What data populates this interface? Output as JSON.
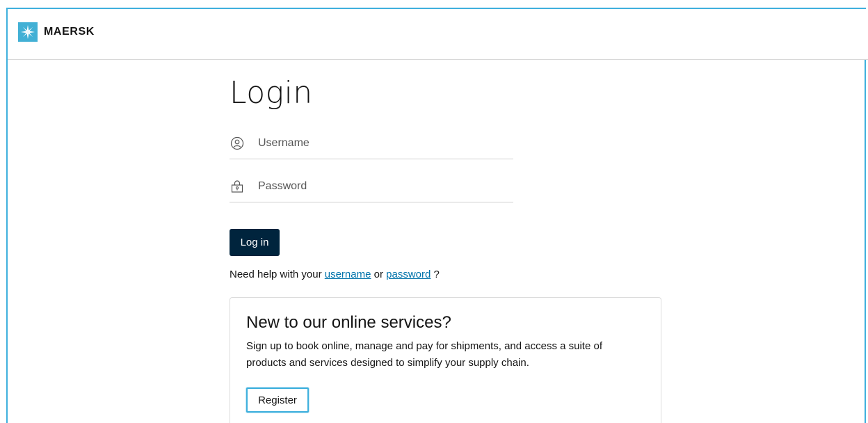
{
  "header": {
    "brand": "MAERSK"
  },
  "login": {
    "title": "Login",
    "username_placeholder": "Username",
    "password_placeholder": "Password",
    "submit_label": "Log in"
  },
  "help": {
    "prefix": "Need help with your",
    "username_link": "username",
    "or": "or",
    "password_link": "password",
    "suffix": "?"
  },
  "register_card": {
    "title": "New to our online services?",
    "body": "Sign up to book online, manage and pay for shipments, and access a suite of products and services designed to simplify your supply chain.",
    "button_label": "Register"
  },
  "colors": {
    "accent": "#42b0d5",
    "primary_button": "#00243d",
    "link": "#0073ab"
  },
  "icons": {
    "logo": "maersk-star-icon",
    "username": "user-icon",
    "password": "lock-icon"
  }
}
